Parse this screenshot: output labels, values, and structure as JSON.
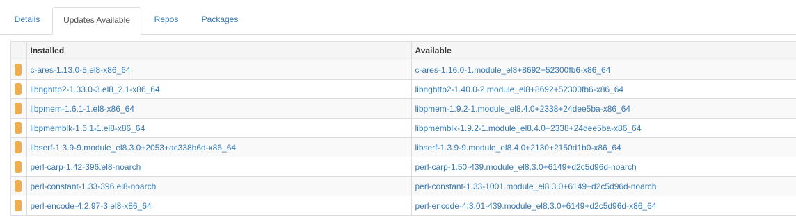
{
  "tabs": [
    {
      "label": "Details"
    },
    {
      "label": "Updates Available"
    },
    {
      "label": "Repos"
    },
    {
      "label": "Packages"
    }
  ],
  "active_tab": "Updates Available",
  "colors": {
    "link": "#337ab7",
    "warning_indicator": "#f0ad4e",
    "border": "#dddddd",
    "stripe": "#f9f9f9"
  },
  "table": {
    "headers": {
      "installed": "Installed",
      "available": "Available"
    },
    "rows": [
      {
        "installed": "c-ares-1.13.0-5.el8-x86_64",
        "available": "c-ares-1.16.0-1.module_el8+8692+52300fb6-x86_64"
      },
      {
        "installed": "libnghttp2-1.33.0-3.el8_2.1-x86_64",
        "available": "libnghttp2-1.40.0-2.module_el8+8692+52300fb6-x86_64"
      },
      {
        "installed": "libpmem-1.6.1-1.el8-x86_64",
        "available": "libpmem-1.9.2-1.module_el8.4.0+2338+24dee5ba-x86_64"
      },
      {
        "installed": "libpmemblk-1.6.1-1.el8-x86_64",
        "available": "libpmemblk-1.9.2-1.module_el8.4.0+2338+24dee5ba-x86_64"
      },
      {
        "installed": "libserf-1.3.9-9.module_el8.3.0+2053+ac338b6d-x86_64",
        "available": "libserf-1.3.9-9.module_el8.4.0+2130+2150d1b0-x86_64"
      },
      {
        "installed": "perl-carp-1.42-396.el8-noarch",
        "available": "perl-carp-1.50-439.module_el8.3.0+6149+d2c5d96d-noarch"
      },
      {
        "installed": "perl-constant-1.33-396.el8-noarch",
        "available": "perl-constant-1.33-1001.module_el8.3.0+6149+d2c5d96d-noarch"
      },
      {
        "installed": "perl-encode-4:2.97-3.el8-x86_64",
        "available": "perl-encode-4:3.01-439.module_el8.3.0+6149+d2c5d96d-x86_64"
      }
    ]
  }
}
